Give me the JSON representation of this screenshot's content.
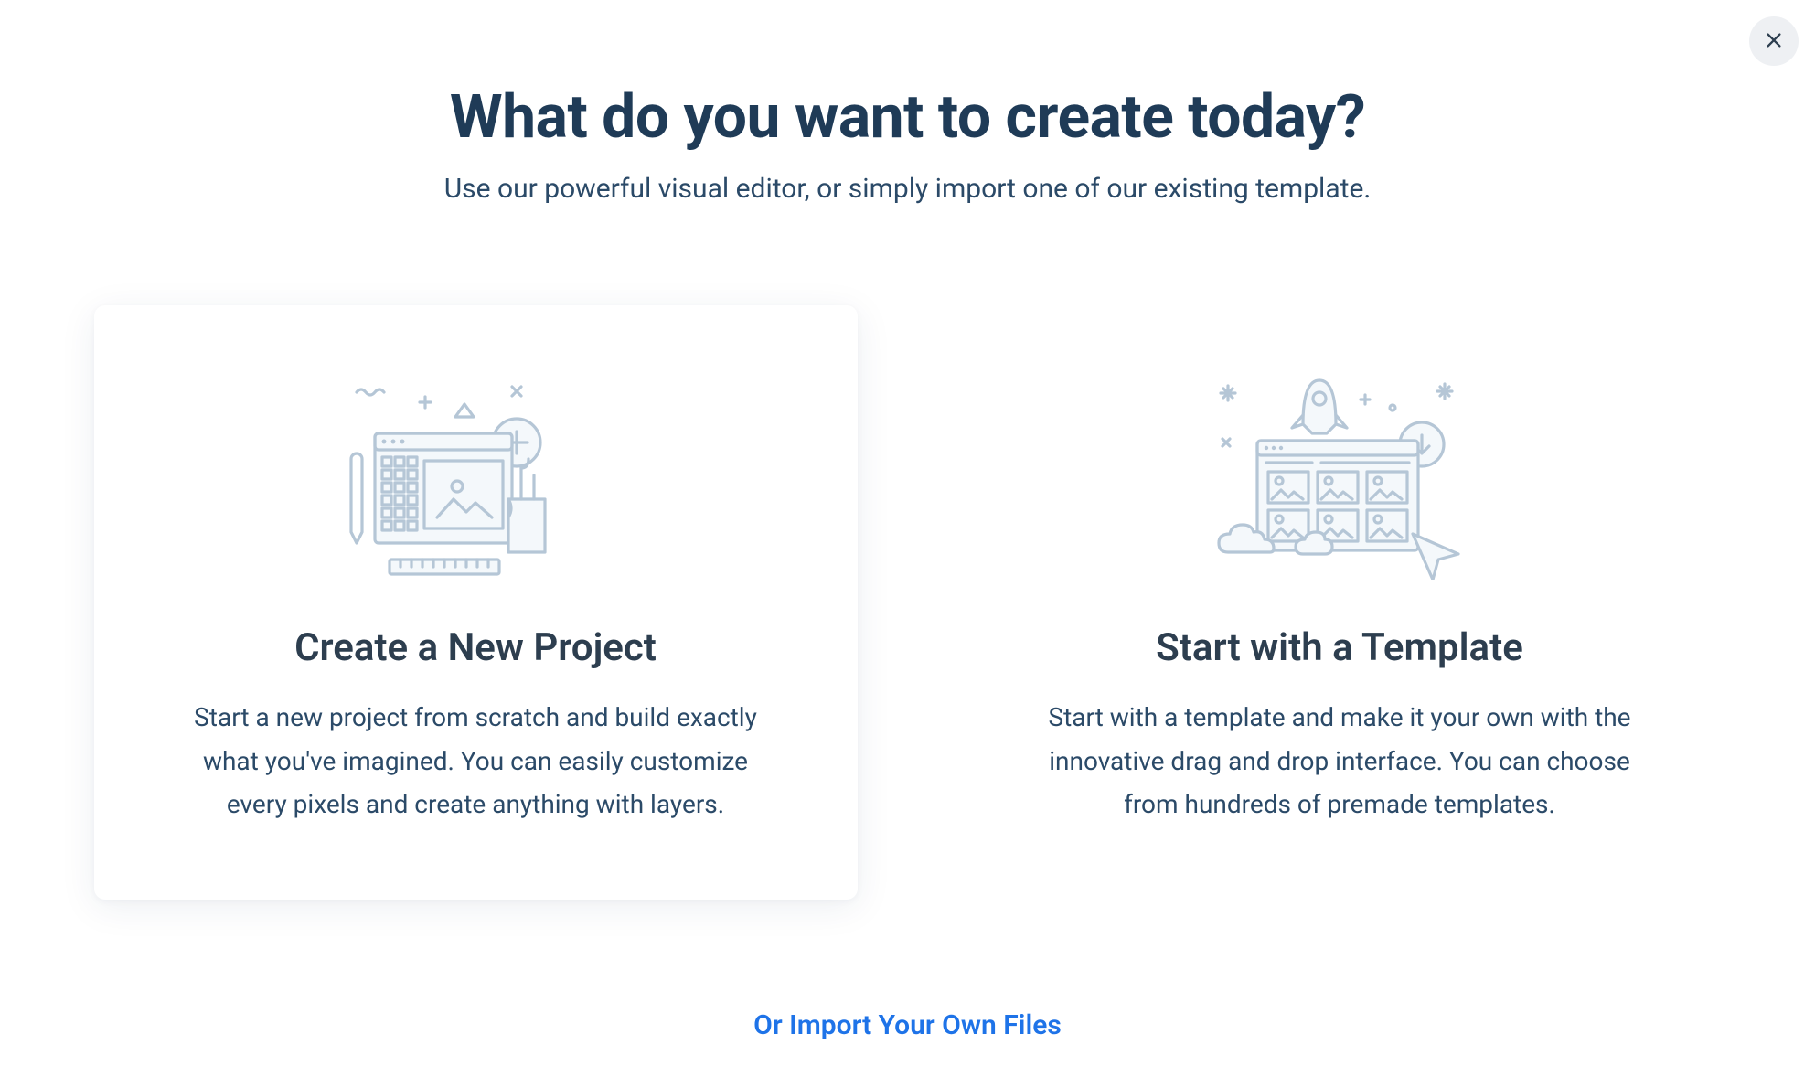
{
  "header": {
    "title": "What do you want to create today?",
    "subtitle": "Use our powerful visual editor, or simply import one of our existing template."
  },
  "options": {
    "new_project": {
      "title": "Create a New Project",
      "description": "Start a new project from scratch and build exactly what you've imagined. You can easily customize every pixels and create anything with layers.",
      "selected": true
    },
    "template": {
      "title": "Start with a Template",
      "description": "Start with a template and make it your own with the innovative drag and drop interface. You can choose from hundreds of premade templates.",
      "selected": false
    }
  },
  "footer": {
    "import_link": "Or Import Your Own Files"
  }
}
